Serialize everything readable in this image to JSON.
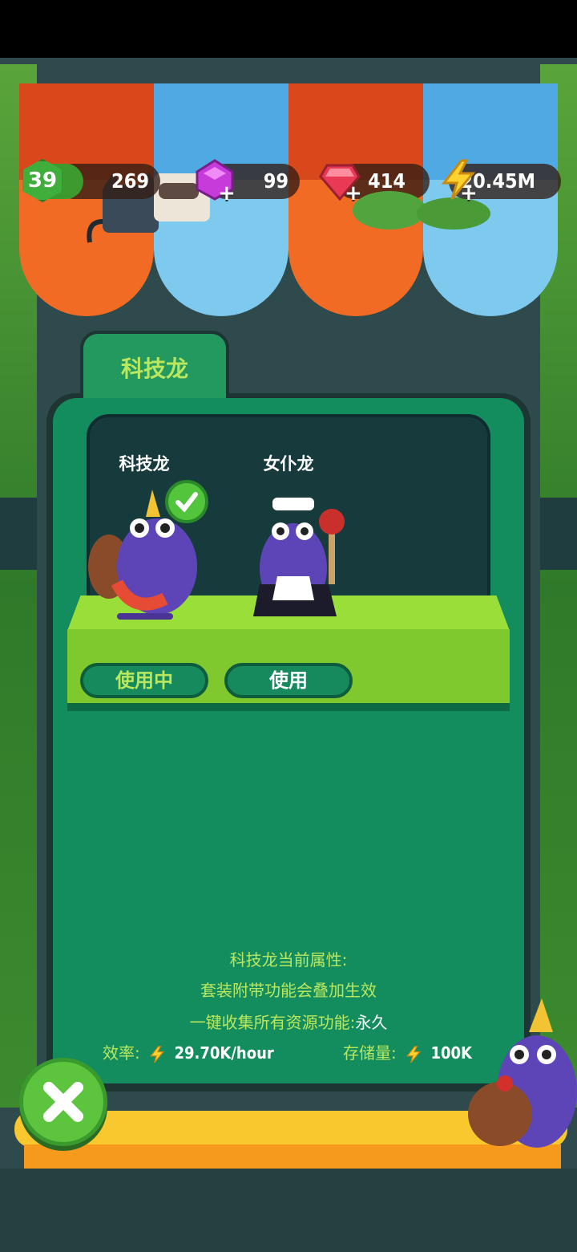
{
  "hud": {
    "level": "39",
    "xp_value": "269",
    "purple_gems": "99",
    "red_gems": "414",
    "energy": "20.45M"
  },
  "panel": {
    "tab_title": "科技龙",
    "characters": [
      {
        "name": "科技龙",
        "button": "使用中",
        "selected": true
      },
      {
        "name": "女仆龙",
        "button": "使用",
        "selected": false
      }
    ],
    "attributes_title": "科技龙当前属性:",
    "attr_line_1": "套装附带功能会叠加生效",
    "attr_line_2_label": "一键收集所有资源功能:",
    "attr_line_2_value": "永久",
    "efficiency_label": "效率:",
    "efficiency_value": "29.70K/hour",
    "storage_label": "存储量:",
    "storage_value": "100K"
  },
  "colors": {
    "accent_green": "#b9e85e",
    "panel_green": "#148d5e",
    "awning_orange": "#f26b24",
    "awning_blue": "#7ec9ee"
  },
  "icons": [
    "level-hex-icon",
    "purple-gem-icon",
    "red-gem-icon",
    "lightning-icon",
    "check-icon",
    "close-icon"
  ]
}
